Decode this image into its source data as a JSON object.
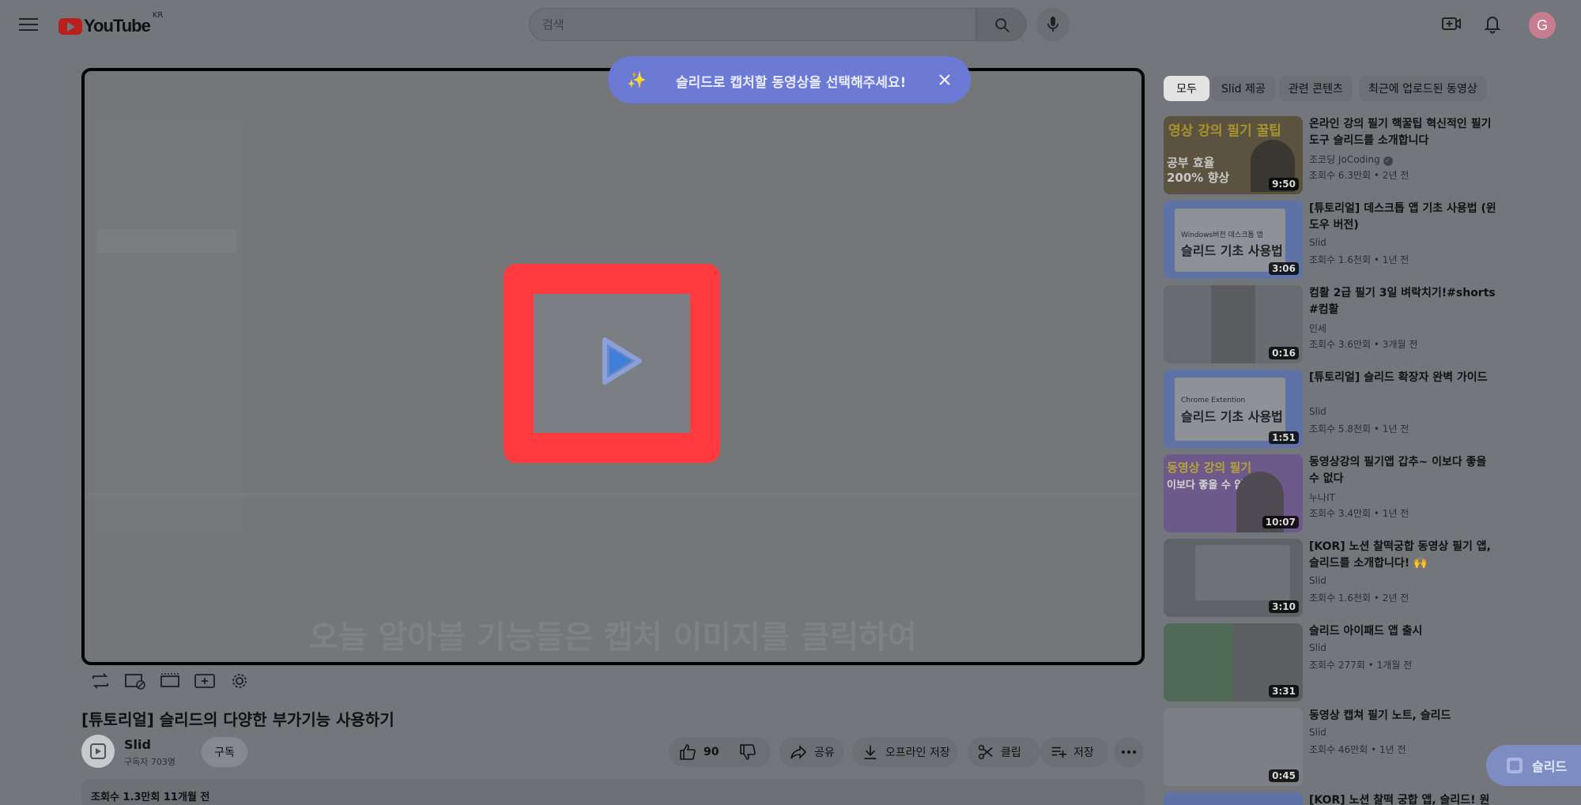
{
  "header": {
    "logo_text": "YouTube",
    "region": "KR",
    "search_placeholder": "검색",
    "avatar_letter": "G"
  },
  "toast": {
    "icon": "sparkles",
    "message": "슬리드로 캡처할 동영상을 선택해주세요!"
  },
  "player": {
    "subtitle": "오늘 알아볼 기능들은 캡처 이미지를 클릭하여"
  },
  "video": {
    "title": "[튜토리얼] 슬리드의 다양한 부가기능 사용하기",
    "channel": "Slid",
    "subscribers": "구독자 703명",
    "subscribe_label": "구독",
    "like_count": "90",
    "share_label": "공유",
    "offline_label": "오프라인 저장",
    "clip_label": "클립",
    "save_label": "저장",
    "views_date": "조회수 1.3만회  11개월 전"
  },
  "chips": [
    "모두",
    "Slid 제공",
    "관련 콘텐츠",
    "최근에 업로드된 동영상"
  ],
  "recommendations": [
    {
      "title": "온라인 강의 필기 핵꿀팁 혁신적인 필기 도구 슬리드를 소개합니다",
      "channel": "조코딩 JoCoding",
      "verified": true,
      "meta": "조회수 6.3만회 • 2년 전",
      "duration": "9:50",
      "thumb_text": "영상 강의 필기 꿀팁",
      "thumb_text2": "공부 효율 200% 향상"
    },
    {
      "title": "[튜토리얼] 데스크톱 앱 기초 사용법 (윈도우 버전)",
      "channel": "Slid",
      "meta": "조회수 1.6천회 • 1년 전",
      "duration": "3:06",
      "thumb_text": "Windows버전 데스크톱 앱",
      "thumb_text2": "슬리드 기초 사용법"
    },
    {
      "title": "컴활 2급 필기 3일 벼락치기!#shorts #컴활",
      "channel": "인세",
      "meta": "조회수 3.6만회 • 3개월 전",
      "duration": "0:16"
    },
    {
      "title": "[튜토리얼] 슬리드 확장자 완벽 가이드",
      "channel": "Slid",
      "meta": "조회수 5.8천회 • 1년 전",
      "duration": "1:51",
      "thumb_text": "Chrome Extention",
      "thumb_text2": "슬리드 기초 사용법"
    },
    {
      "title": "동영상강의 필기앱 갑추~ 이보다 좋을 수 없다",
      "channel": "누나IT",
      "meta": "조회수 3.4만회 • 1년 전",
      "duration": "10:07",
      "thumb_text": "동영상 강의 필기",
      "thumb_text2": "이보다 좋을 수 없다"
    },
    {
      "title": "[KOR] 노션 찰떡궁합 동영상 필기 앱, 슬리드를 소개합니다! 🙌",
      "channel": "Slid",
      "meta": "조회수 1.6천회 • 2년 전",
      "duration": "3:10"
    },
    {
      "title": "슬리드 아이패드 앱 출시",
      "channel": "Slid",
      "meta": "조회수 277회 • 1개월 전",
      "duration": "3:31"
    },
    {
      "title": "동영상 캡쳐 필기 노트, 슬리드",
      "channel": "Slid",
      "meta": "조회수 46만회 • 1년 전",
      "duration": "0:45"
    },
    {
      "title": "[KOR] 노션 찰떡 궁합 앱, 슬리드! 원",
      "channel": "",
      "meta": "",
      "duration": ""
    }
  ],
  "fab": {
    "label": "슬리드"
  }
}
